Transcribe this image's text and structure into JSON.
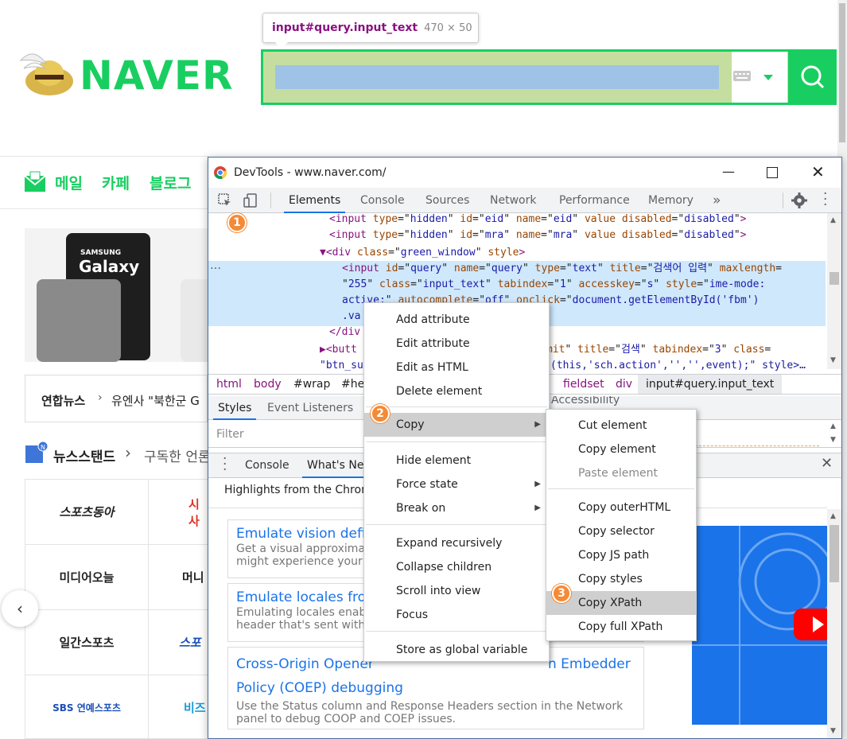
{
  "naver": {
    "tooltip_selector": "input#query.input_text",
    "tooltip_size": "470 × 50",
    "logo": "NAVER",
    "nav": [
      "메일",
      "카페",
      "블로그"
    ],
    "banner_text": "Galaxy",
    "banner_brand": "SAMSUNG",
    "news_source": "연합뉴스",
    "news_headline": "유엔사 \"북한군 G",
    "newsstand_label": "뉴스스탠드",
    "newsstand_sub": "구독한 언론",
    "press": [
      "스포츠동아",
      "시사",
      "미디어오늘",
      "머니",
      "일간스포츠",
      "스포",
      "SBS 연예스포츠",
      "비즈"
    ]
  },
  "devtools": {
    "title": "DevTools - www.naver.com/",
    "tabs": [
      "Elements",
      "Console",
      "Sources",
      "Network",
      "Performance",
      "Memory"
    ],
    "more_tabs": "»",
    "code_lines": [
      {
        "indent": "          ",
        "parts": [
          [
            "tag",
            "<input "
          ],
          [
            "attr",
            "type"
          ],
          [
            "txt",
            "=\""
          ],
          [
            "val",
            "hidden"
          ],
          [
            "txt",
            "\" "
          ],
          [
            "attr",
            "id"
          ],
          [
            "txt",
            "=\""
          ],
          [
            "val",
            "eid"
          ],
          [
            "txt",
            "\" "
          ],
          [
            "attr",
            "name"
          ],
          [
            "txt",
            "=\""
          ],
          [
            "val",
            "eid"
          ],
          [
            "txt",
            "\" "
          ],
          [
            "attr",
            "value disabled"
          ],
          [
            "txt",
            "=\""
          ],
          [
            "val",
            "disabled"
          ],
          [
            "txt",
            "\">"
          ]
        ]
      },
      {
        "indent": "          ",
        "parts": [
          [
            "tag",
            "<input "
          ],
          [
            "attr",
            "type"
          ],
          [
            "txt",
            "=\""
          ],
          [
            "val",
            "hidden"
          ],
          [
            "txt",
            "\" "
          ],
          [
            "attr",
            "id"
          ],
          [
            "txt",
            "=\""
          ],
          [
            "val",
            "mra"
          ],
          [
            "txt",
            "\" "
          ],
          [
            "attr",
            "name"
          ],
          [
            "txt",
            "=\""
          ],
          [
            "val",
            "mra"
          ],
          [
            "txt",
            "\" "
          ],
          [
            "attr",
            "value disabled"
          ],
          [
            "txt",
            "=\""
          ],
          [
            "val",
            "disabled"
          ],
          [
            "txt",
            "\">"
          ]
        ]
      }
    ],
    "code_div": "▼<div class=\"green_window\" style>",
    "code_sel1": "<input id=\"query\" name=\"query\" type=\"text\" title=\"검색어 입력\" maxlength=",
    "code_sel2": "\"255\" class=\"input_text\" tabindex=\"1\" accesskey=\"s\" style=\"ime-mode:",
    "code_sel3": "active;\" autocomplete=\"off\" onclick=\"document.getElementById('fbm')",
    "code_sel4": ".va",
    "code_enddiv": "</div",
    "code_button": "▶<butt",
    "code_button_rest": "mit\" title=\"검색\" tabindex=\"3\" class=",
    "code_btn2a": "\"btn_su",
    "code_btn2b": "(this,'sch.action','','',event);\" style>…",
    "ellipsis": "…",
    "crumbs": [
      "html",
      "body",
      "#wrap",
      "#hea",
      "fieldset",
      "div",
      "input#query.input_text"
    ],
    "subtabs": [
      "Styles",
      "Event Listeners",
      "Accessibility"
    ],
    "filter_placeholder": "Filter",
    "drawer_tabs": [
      "Console",
      "What's Ne"
    ],
    "highlights": "Highlights from the Chrom",
    "cards": [
      {
        "title": "Emulate vision defici",
        "desc1": "Get a visual approxima",
        "desc2": "might experience your"
      },
      {
        "title": "Emulate locales from",
        "desc1": "Emulating locales enab",
        "desc2": "header that's sent with"
      },
      {
        "title": "Cross-Origin Opener",
        "title_rest": "n Embedder",
        "title2": "Policy (COEP) debugging",
        "desc1": "Use the Status column and Response Headers section in the Network",
        "desc2": "panel to debug COOP and COEP issues."
      }
    ]
  },
  "context_menu": {
    "items": [
      "Add attribute",
      "Edit attribute",
      "Edit as HTML",
      "Delete element",
      "Copy",
      "Hide element",
      "Force state",
      "Break on",
      "Expand recursively",
      "Collapse children",
      "Scroll into view",
      "Focus",
      "Store as global variable"
    ]
  },
  "copy_submenu": {
    "items": [
      "Cut element",
      "Copy element",
      "Paste element",
      "Copy outerHTML",
      "Copy selector",
      "Copy JS path",
      "Copy styles",
      "Copy XPath",
      "Copy full XPath"
    ]
  },
  "badges": [
    "1",
    "2",
    "3"
  ],
  "colors": {
    "naver_green": "#19ce60",
    "badge_orange": "#f58a36",
    "dt_accent": "#1a73e8"
  }
}
